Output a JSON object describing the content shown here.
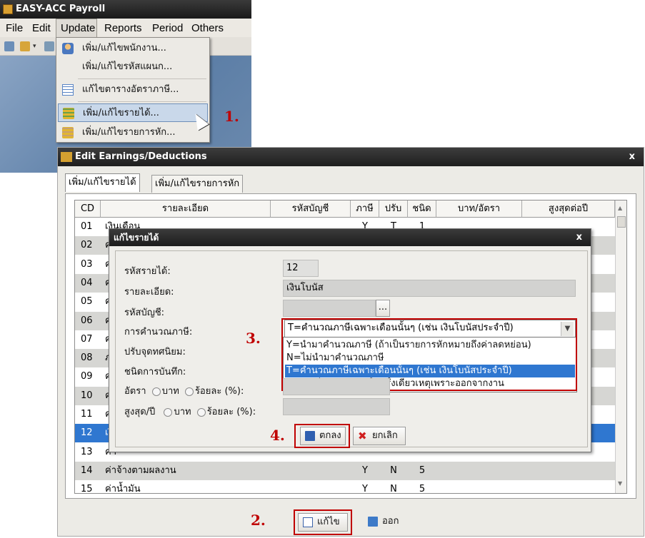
{
  "app": {
    "title": "EASY-ACC Payroll",
    "menus": [
      "File",
      "Edit",
      "Update",
      "Reports",
      "Period",
      "Others"
    ]
  },
  "update_menu": {
    "items": [
      "เพิ่ม/แก้ไขพนักงาน...",
      "เพิ่ม/แก้ไขรหัสแผนก...",
      "แก้ไขตารางอัตราภาษี...",
      "เพิ่ม/แก้ไขรายได้...",
      "เพิ่ม/แก้ไขรายการหัก..."
    ],
    "highlighted_index": 3
  },
  "steps": {
    "s1": "1.",
    "s2": "2.",
    "s3": "3.",
    "s4": "4."
  },
  "edit_window": {
    "title": "Edit Earnings/Deductions",
    "close": "x",
    "tabs": [
      "เพิ่ม/แก้ไขรายได้",
      "เพิ่ม/แก้ไขรายการหัก"
    ],
    "columns": [
      "CD",
      "รายละเอียด",
      "รหัสบัญชี",
      "ภาษี",
      "ปรับ",
      "ชนิด",
      "บาท/อัตรา",
      "สูงสุดต่อปี"
    ],
    "rows": [
      {
        "cd": "01",
        "desc": "เงินเดือน",
        "acct": "",
        "tax": "Y",
        "adj": "T",
        "type": "1"
      },
      {
        "cd": "02",
        "desc": "ค่า",
        "acct": "",
        "tax": "",
        "adj": "",
        "type": ""
      },
      {
        "cd": "03",
        "desc": "ค่า",
        "acct": "",
        "tax": "",
        "adj": "",
        "type": ""
      },
      {
        "cd": "04",
        "desc": "ค่า",
        "acct": "",
        "tax": "",
        "adj": "",
        "type": ""
      },
      {
        "cd": "05",
        "desc": "ค่า",
        "acct": "",
        "tax": "",
        "adj": "",
        "type": ""
      },
      {
        "cd": "06",
        "desc": "ค่า",
        "acct": "",
        "tax": "",
        "adj": "",
        "type": ""
      },
      {
        "cd": "07",
        "desc": "ค่า",
        "acct": "",
        "tax": "",
        "adj": "",
        "type": ""
      },
      {
        "cd": "08",
        "desc": "ภ",
        "acct": "",
        "tax": "",
        "adj": "",
        "type": ""
      },
      {
        "cd": "09",
        "desc": "ค่า",
        "acct": "",
        "tax": "",
        "adj": "",
        "type": ""
      },
      {
        "cd": "10",
        "desc": "ค่า",
        "acct": "",
        "tax": "",
        "adj": "",
        "type": ""
      },
      {
        "cd": "11",
        "desc": "ค่า",
        "acct": "",
        "tax": "",
        "adj": "",
        "type": ""
      },
      {
        "cd": "12",
        "desc": "เงิ",
        "acct": "",
        "tax": "",
        "adj": "",
        "type": ""
      },
      {
        "cd": "13",
        "desc": "ค่า",
        "acct": "",
        "tax": "",
        "adj": "",
        "type": ""
      },
      {
        "cd": "14",
        "desc": "ค่าจ้างตามผลงาน",
        "acct": "",
        "tax": "Y",
        "adj": "N",
        "type": "5"
      },
      {
        "cd": "15",
        "desc": "ค่าน้ำมัน",
        "acct": "",
        "tax": "Y",
        "adj": "N",
        "type": "5"
      }
    ],
    "selected_row_index": 11,
    "edit_button": "แก้ไข",
    "exit_button": "ออก"
  },
  "dialog": {
    "title": "แก้ไขรายได้",
    "close": "x",
    "labels": {
      "code": "รหัสรายได้:",
      "desc": "รายละเอียด:",
      "acct": "รหัสบัญชี:",
      "tax_calc": "การคำนวณภาษี:",
      "rounding": "ปรับจุดทศนิยม:",
      "record_type": "ชนิดการบันทึก:",
      "rate": "อัตรา",
      "max_year": "สูงสุด/ปี"
    },
    "radio_baht": "บาท",
    "radio_percent": "ร้อยละ (%):",
    "code_value": "12",
    "desc_value": "เงินโบนัส",
    "acct_value": "",
    "browse": "...",
    "tax_selected": "T=คำนวณภาษีเฉพาะเดือนนั้นๆ (เช่น เงินโบนัสประจำปี)",
    "tax_options": [
      "Y=นำมาคำนวณภาษี (ถ้าเป็นรายการหักหมายถึงค่าลดหย่อน)",
      "N=ไม่นำมาคำนวณภาษี",
      "T=คำนวณภาษีเฉพาะเดือนนั้นๆ (เช่น เงินโบนัสประจำปี)",
      "X=เงินที่นายจ้างจ่ายให้ครั้งเดียวเหตุเพราะออกจากงาน"
    ],
    "tax_highlighted_index": 2,
    "ok_button": "ตกลง",
    "cancel_button": "ยกเลิก"
  },
  "colors": {
    "accent_red": "#c00000",
    "selection_blue": "#2f77d0"
  }
}
